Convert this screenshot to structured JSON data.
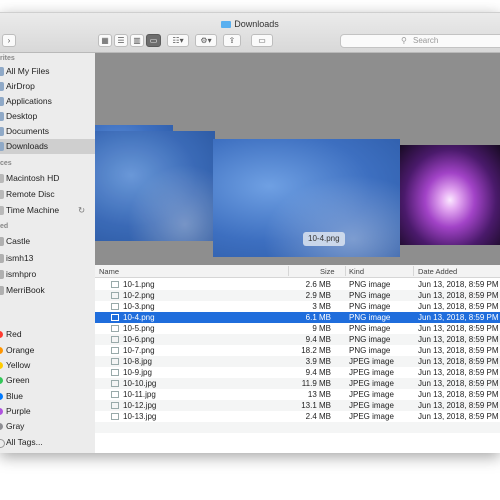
{
  "window": {
    "title": "Downloads"
  },
  "toolbar": {
    "back_glyph": "‹",
    "forward_glyph": "›",
    "share_glyph": "⇪",
    "tag_glyph": "▭",
    "gear_glyph": "⚙▾",
    "group_glyph": "☷▾",
    "search_glyph": "⚲",
    "search_placeholder": "Search"
  },
  "sidebar": {
    "favorites_header": "rites",
    "favorites": [
      {
        "label": "All My Files"
      },
      {
        "label": "AirDrop"
      },
      {
        "label": "Applications"
      },
      {
        "label": "Desktop"
      },
      {
        "label": "Documents"
      },
      {
        "label": "Downloads"
      }
    ],
    "devices_header": "ces",
    "devices": [
      {
        "label": "Macintosh HD"
      },
      {
        "label": "Remote Disc"
      },
      {
        "label": "Time Machine"
      }
    ],
    "shared_header": "ed",
    "shared": [
      {
        "label": "Castle"
      },
      {
        "label": "ismh13"
      },
      {
        "label": "ismhpro"
      },
      {
        "label": "MerriBook"
      }
    ],
    "tags": [
      {
        "label": "Red",
        "color": "#ff3b30"
      },
      {
        "label": "Orange",
        "color": "#ff9500"
      },
      {
        "label": "Yellow",
        "color": "#ffcc00"
      },
      {
        "label": "Green",
        "color": "#34c759"
      },
      {
        "label": "Blue",
        "color": "#007aff"
      },
      {
        "label": "Purple",
        "color": "#af52de"
      },
      {
        "label": "Gray",
        "color": "#8e8e93"
      },
      {
        "label": "All Tags...",
        "color": "#d0d0d0"
      }
    ]
  },
  "preview": {
    "selected_label": "10-4.png"
  },
  "columns": {
    "name": "Name",
    "size": "Size",
    "kind": "Kind",
    "date": "Date Added"
  },
  "files": [
    {
      "name": "10-1.png",
      "size": "2.6 MB",
      "kind": "PNG image",
      "date": "Jun 13, 2018, 8:59 PM"
    },
    {
      "name": "10-2.png",
      "size": "2.9 MB",
      "kind": "PNG image",
      "date": "Jun 13, 2018, 8:59 PM"
    },
    {
      "name": "10-3.png",
      "size": "3 MB",
      "kind": "PNG image",
      "date": "Jun 13, 2018, 8:59 PM"
    },
    {
      "name": "10-4.png",
      "size": "6.1 MB",
      "kind": "PNG image",
      "date": "Jun 13, 2018, 8:59 PM"
    },
    {
      "name": "10-5.png",
      "size": "9 MB",
      "kind": "PNG image",
      "date": "Jun 13, 2018, 8:59 PM"
    },
    {
      "name": "10-6.png",
      "size": "9.4 MB",
      "kind": "PNG image",
      "date": "Jun 13, 2018, 8:59 PM"
    },
    {
      "name": "10-7.png",
      "size": "18.2 MB",
      "kind": "PNG image",
      "date": "Jun 13, 2018, 8:59 PM"
    },
    {
      "name": "10-8.jpg",
      "size": "3.9 MB",
      "kind": "JPEG image",
      "date": "Jun 13, 2018, 8:59 PM"
    },
    {
      "name": "10-9.jpg",
      "size": "9.4 MB",
      "kind": "JPEG image",
      "date": "Jun 13, 2018, 8:59 PM"
    },
    {
      "name": "10-10.jpg",
      "size": "11.9 MB",
      "kind": "JPEG image",
      "date": "Jun 13, 2018, 8:59 PM"
    },
    {
      "name": "10-11.jpg",
      "size": "13 MB",
      "kind": "JPEG image",
      "date": "Jun 13, 2018, 8:59 PM"
    },
    {
      "name": "10-12.jpg",
      "size": "13.1 MB",
      "kind": "JPEG image",
      "date": "Jun 13, 2018, 8:59 PM"
    },
    {
      "name": "10-13.jpg",
      "size": "2.4 MB",
      "kind": "JPEG image",
      "date": "Jun 13, 2018, 8:59 PM"
    }
  ],
  "selected_index": 3
}
